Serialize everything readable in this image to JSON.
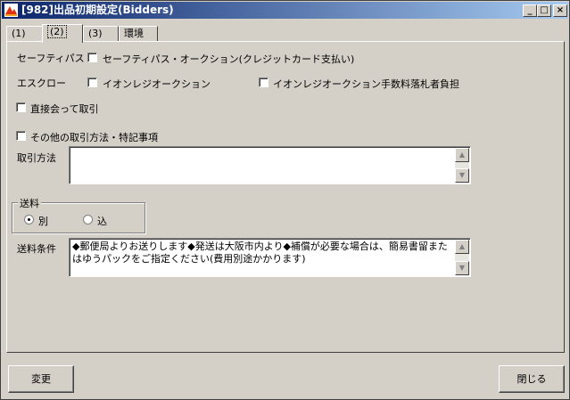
{
  "window": {
    "title": "[982]出品初期設定(Bidders)",
    "controls": {
      "minimize": "_",
      "maximize": "□",
      "close": "×"
    }
  },
  "tabs": [
    {
      "label": "(1)"
    },
    {
      "label": "(2)",
      "active": true
    },
    {
      "label": "(3)"
    },
    {
      "label": "環境"
    }
  ],
  "form": {
    "safety_pass_label": "セーフティパス",
    "safety_pass_option": "セーフティパス・オークション(クレジットカード支払い)",
    "escrow_label": "エスクロー",
    "escrow_option1": "イオンレジオークション",
    "escrow_option2": "イオンレジオークション手数料落札者負担",
    "direct_trade": "直接会って取引",
    "other_methods": "その他の取引方法・特記事項",
    "trade_method_label": "取引方法",
    "trade_method_value": "",
    "shipping_group_label": "送料",
    "shipping_radio1": "別",
    "shipping_radio2": "込",
    "shipping_selected": "別",
    "shipping_terms_label": "送料条件",
    "shipping_terms_value": "◆郵便局よりお送りします◆発送は大阪市内より◆補償が必要な場合は、簡易書留またはゆうパックをご指定ください(費用別途かかります)"
  },
  "buttons": {
    "change": "変更",
    "close": "閉じる"
  },
  "colors": {
    "title_start": "#0a246a",
    "title_end": "#a6caf0",
    "face": "#d4d0c8"
  },
  "icons": {
    "app": "app-icon",
    "scroll_up": "arrow-up-icon",
    "scroll_down": "arrow-down-icon"
  }
}
